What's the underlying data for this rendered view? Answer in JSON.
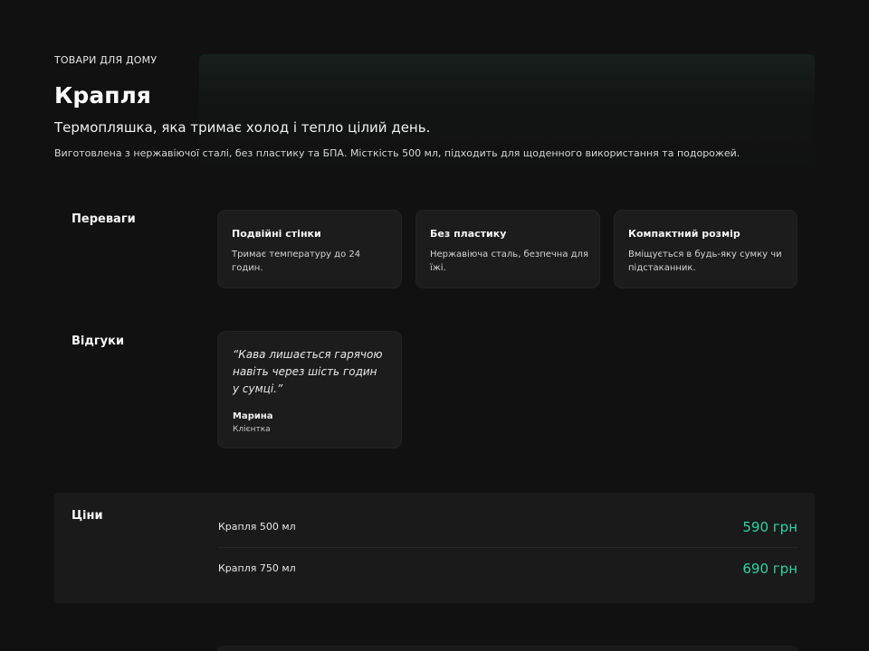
{
  "hero": {
    "eyebrow": "ТОВАРИ ДЛЯ ДОМУ",
    "title": "Крапля",
    "subtitle": "Термопляшка, яка тримає холод і тепло цілий день.",
    "description": "Виготовлена з нержавіючої сталі, без пластику та БПА. Місткість 500 мл, підходить для щоденного використання та подорожей."
  },
  "advantages": {
    "label": "Переваги",
    "items": [
      {
        "title": "Подвійні стінки",
        "text": "Тримає температуру до 24 годин."
      },
      {
        "title": "Без пластику",
        "text": "Нержавіюча сталь, безпечна для їжі."
      },
      {
        "title": "Компактний розмір",
        "text": "Вміщується в будь-яку сумку чи підстаканник."
      }
    ]
  },
  "reviews": {
    "label": "Відгуки",
    "items": [
      {
        "quote": "“Кава лишається гарячою навіть через шість годин у сумці.”",
        "author": "Марина",
        "role": "Клієнтка"
      }
    ]
  },
  "prices": {
    "label": "Ціни",
    "rows": [
      {
        "name": "Крапля 500 мл",
        "price": "590 грн"
      },
      {
        "name": "Крапля 750 мл",
        "price": "690 грн"
      }
    ]
  },
  "colors": {
    "background": "#111111",
    "card": "#1c1c1c",
    "accent": "#2fd3a3"
  }
}
